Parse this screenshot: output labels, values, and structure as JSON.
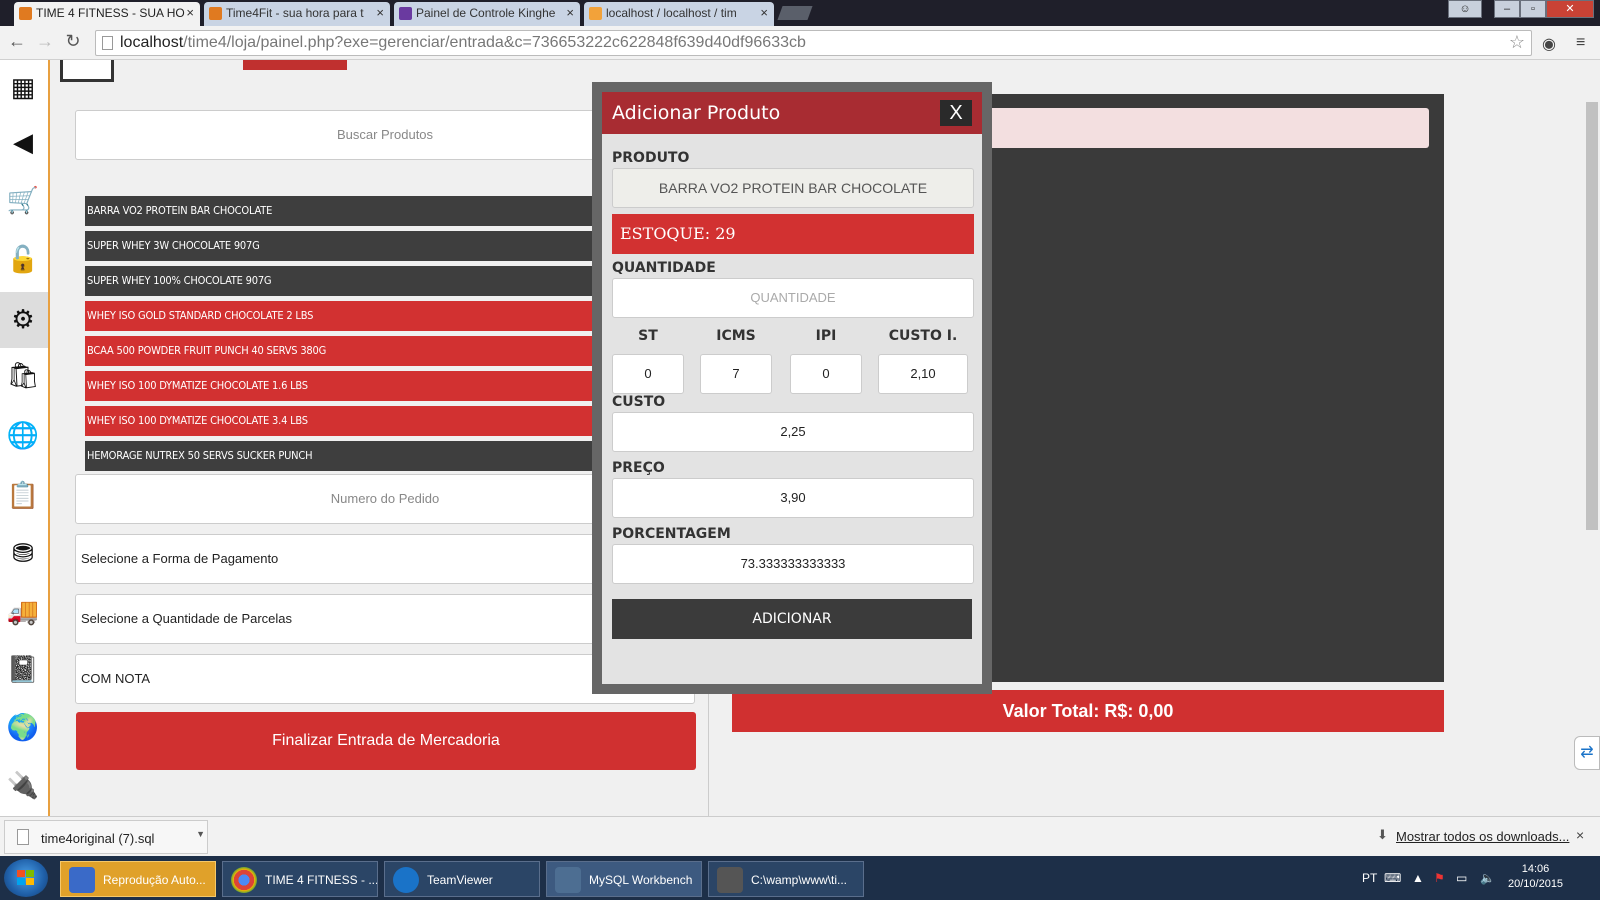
{
  "browser": {
    "tabs": [
      {
        "title": "TIME 4 FITNESS - SUA HO",
        "active": true
      },
      {
        "title": "Time4Fit - sua hora para t",
        "active": false
      },
      {
        "title": "Painel de Controle Kinghe",
        "active": false
      },
      {
        "title": "localhost / localhost / tim",
        "active": false
      }
    ],
    "tab_close": "×",
    "url_host": "localhost",
    "url_path": "/time4/loja/painel.php?exe=gerenciar/entrada&c=736653222c622848f639d40df96633cb"
  },
  "form": {
    "search_placeholder": "Buscar Produtos",
    "order_placeholder": "Numero do Pedido",
    "payment_select": "Selecione a Forma de Pagamento",
    "installments_select": "Selecione a Quantidade de Parcelas",
    "invoice_select": "COM NOTA",
    "finish_button": "Finalizar Entrada de Mercadoria"
  },
  "products": [
    {
      "name": "BARRA VO2 PROTEIN BAR CHOCOLATE",
      "style": "dark"
    },
    {
      "name": "SUPER WHEY 3W CHOCOLATE 907G",
      "style": "dark"
    },
    {
      "name": "SUPER WHEY 100% CHOCOLATE 907G",
      "style": "dark"
    },
    {
      "name": "WHEY ISO GOLD STANDARD CHOCOLATE 2 LBS",
      "style": "red"
    },
    {
      "name": "BCAA 500 POWDER FRUIT PUNCH 40 SERVS 380G",
      "style": "red"
    },
    {
      "name": "WHEY ISO 100 DYMATIZE CHOCOLATE 1.6 LBS",
      "style": "red"
    },
    {
      "name": "WHEY ISO 100 DYMATIZE CHOCOLATE 3.4 LBS",
      "style": "red"
    },
    {
      "name": "HEMORAGE NUTREX 50 SERVS SUCKER PUNCH",
      "style": "dark"
    }
  ],
  "total": {
    "label": "Valor Total: R$: 0,00"
  },
  "modal": {
    "title": "Adicionar Produto",
    "close": "X",
    "produto_label": "PRODUTO",
    "produto_value": "BARRA VO2  PROTEIN BAR CHOCOLATE",
    "estoque": "ESTOQUE: 29",
    "quantidade_label": "QUANTIDADE",
    "quantidade_placeholder": "QUANTIDADE",
    "st_label": "ST",
    "st_value": "0",
    "icms_label": "ICMS",
    "icms_value": "7",
    "ipi_label": "IPI",
    "ipi_value": "0",
    "custo_i_label": "CUSTO I.",
    "custo_i_value": "2,10",
    "custo_label": "CUSTO",
    "custo_value": "2,25",
    "preco_label": "PREÇO",
    "preco_value": "3,90",
    "porcentagem_label": "PORCENTAGEM",
    "porcentagem_value": "73.333333333333",
    "add_button": "ADICIONAR"
  },
  "downloads": {
    "file": "time4original (7).sql",
    "show_all": "Mostrar todos os downloads...",
    "close": "×"
  },
  "taskbar": {
    "items": [
      "Reprodução Auto...",
      "TIME 4 FITNESS - ...",
      "TeamViewer",
      "MySQL Workbench",
      "C:\\wamp\\www\\ti..."
    ],
    "lang": "PT",
    "time": "14:06",
    "date": "20/10/2015"
  },
  "colors": {
    "accent_red": "#d03030",
    "header_red": "#a82c32",
    "dark": "#3a3a3a"
  }
}
